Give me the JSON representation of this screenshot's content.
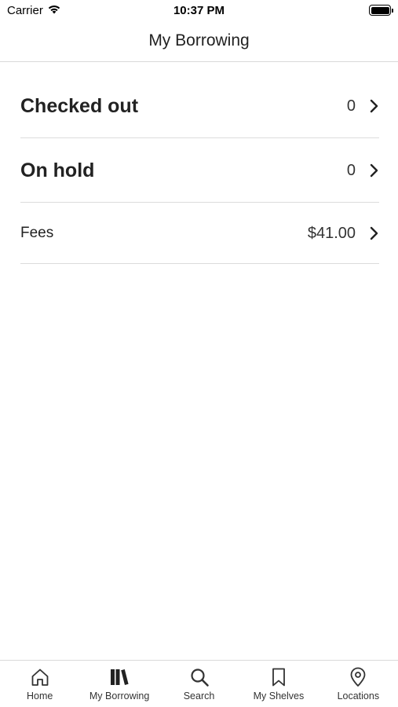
{
  "status_bar": {
    "carrier": "Carrier",
    "time": "10:37 PM"
  },
  "nav": {
    "title": "My Borrowing"
  },
  "rows": [
    {
      "label": "Checked out",
      "value": "0"
    },
    {
      "label": "On hold",
      "value": "0"
    },
    {
      "label": "Fees",
      "value": "$41.00"
    }
  ],
  "tab_bar": {
    "tabs": [
      {
        "label": "Home",
        "icon": "home-icon"
      },
      {
        "label": "My Borrowing",
        "icon": "books-icon",
        "selected": true
      },
      {
        "label": "Search",
        "icon": "search-icon"
      },
      {
        "label": "My Shelves",
        "icon": "bookmark-icon"
      },
      {
        "label": "Locations",
        "icon": "location-pin-icon"
      }
    ]
  },
  "colors": {
    "text": "#222222",
    "divider": "#dcdcdc",
    "background": "#ffffff"
  }
}
